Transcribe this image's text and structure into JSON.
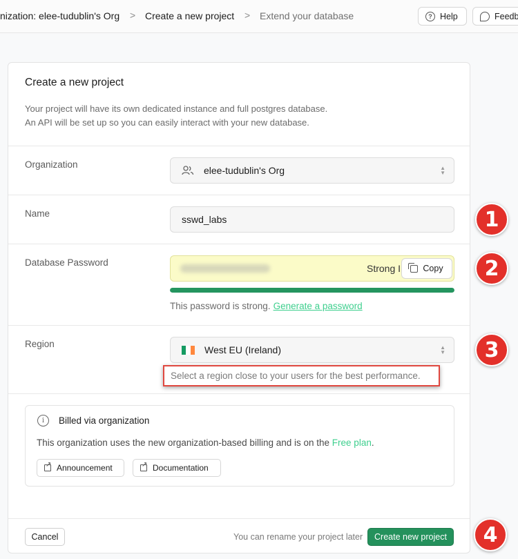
{
  "breadcrumb": {
    "org": "nization: elee-tudublin's Org",
    "create": "Create a new project",
    "extend": "Extend your database",
    "separator": ">"
  },
  "topbar": {
    "help_label": "Help",
    "feedback_label": "Feedb"
  },
  "form": {
    "title": "Create a new project",
    "desc_line1": "Your project will have its own dedicated instance and full postgres database.",
    "desc_line2": "An API will be set up so you can easily interact with your new database.",
    "org_label": "Organization",
    "org_value": "elee-tudublin's Org",
    "name_label": "Name",
    "name_value": "sswd_labs",
    "pw_label": "Database Password",
    "pw_strength_text": "Strong I",
    "copy_label": "Copy",
    "pw_strength_fraction": 1.0,
    "pw_note": "This password is strong.",
    "pw_generate": "Generate a password",
    "region_label": "Region",
    "region_value": "West EU (Ireland)",
    "region_hint": "Select a region close to your users for the best performance."
  },
  "billing": {
    "title": "Billed via organization",
    "text": "This organization uses the new organization-based billing and is on the",
    "plan": "Free plan",
    "plan_suffix": ".",
    "announcement": "Announcement",
    "documentation": "Documentation"
  },
  "footer": {
    "cancel": "Cancel",
    "rename_note": "You can rename your project later",
    "create": "Create new project"
  },
  "markers": [
    "1",
    "2",
    "3",
    "4"
  ],
  "colors": {
    "accent": "#3ecf8e",
    "primary_button": "#24915c",
    "marker": "#e3302a",
    "highlight_box": "#e0473f",
    "password_bg": "#fbfbc8"
  }
}
